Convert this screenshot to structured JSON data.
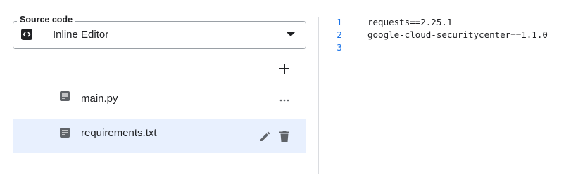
{
  "source": {
    "label": "Source code",
    "value": "Inline Editor"
  },
  "files": [
    {
      "name": "main.py",
      "selected": false
    },
    {
      "name": "requirements.txt",
      "selected": true
    }
  ],
  "editor": {
    "lines": [
      {
        "num": "1",
        "text": "requests==2.25.1"
      },
      {
        "num": "2",
        "text": "google-cloud-securitycenter==1.1.0"
      },
      {
        "num": "3",
        "text": ""
      }
    ]
  },
  "colors": {
    "selected_row_bg": "#e8f0fe",
    "line_number": "#1a73e8",
    "icon_grey": "#5f6368"
  }
}
